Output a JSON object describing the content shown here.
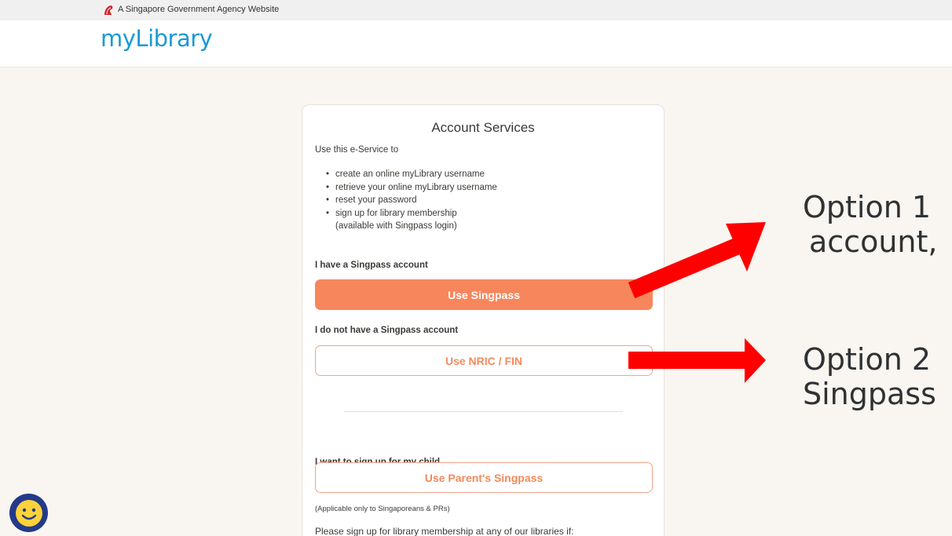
{
  "gov_banner": {
    "text": "A Singapore Government Agency Website"
  },
  "header": {
    "logo": "myLibrary"
  },
  "card": {
    "title": "Account Services",
    "intro": "Use this e-Service to",
    "bullets": [
      "create an online myLibrary username",
      "retrieve your online myLibrary username",
      "reset your password",
      "sign up for library membership",
      "(available with Singpass login)"
    ],
    "singpass_label": "I have a Singpass account",
    "singpass_button": "Use Singpass",
    "no_singpass_label": "I do not have a Singpass account",
    "nric_button": "Use NRIC / FIN",
    "child_label": "I want to sign up for my child",
    "parent_button": "Use Parent's Singpass",
    "applicable_note": "(Applicable only to Singaporeans & PRs)",
    "footer_text": "Please sign up for library membership at any of our libraries if:"
  },
  "annotations": {
    "option1_line1": "Option 1",
    "option1_line2": "account,",
    "option2_line1": "Option 2",
    "option2_line2": "Singpass",
    "arrow_color": "#ff0000"
  },
  "colors": {
    "accent": "#f8865d",
    "logo": "#1a99d6",
    "page_bg": "#f9f5f0"
  },
  "icons": {
    "gov": "lion-head-icon",
    "chat": "smiley-face-icon"
  }
}
